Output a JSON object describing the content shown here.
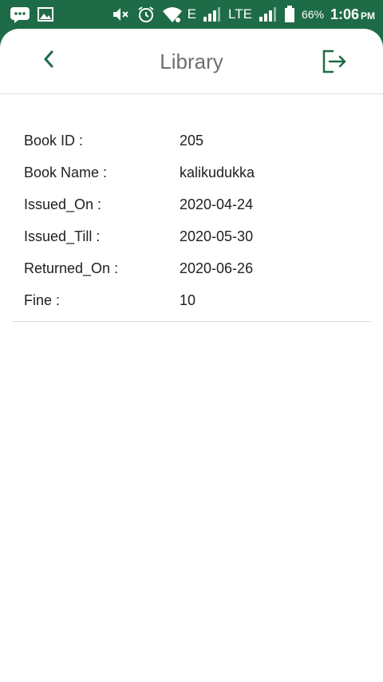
{
  "status_bar": {
    "battery_percent": "66%",
    "time": "1:06",
    "ampm": "PM",
    "network_e": "E",
    "network_lte": "LTE"
  },
  "header": {
    "title": "Library"
  },
  "details": [
    {
      "label": "Book ID :",
      "value": "205"
    },
    {
      "label": "Book Name :",
      "value": "kalikudukka"
    },
    {
      "label": "Issued_On :",
      "value": "2020-04-24"
    },
    {
      "label": "Issued_Till :",
      "value": "2020-05-30"
    },
    {
      "label": "Returned_On :",
      "value": "2020-06-26"
    },
    {
      "label": "Fine :",
      "value": "10"
    }
  ],
  "colors": {
    "status_bar_bg": "#1e6b47",
    "accent": "#1e6b47",
    "title_text": "#6f6f6f"
  }
}
